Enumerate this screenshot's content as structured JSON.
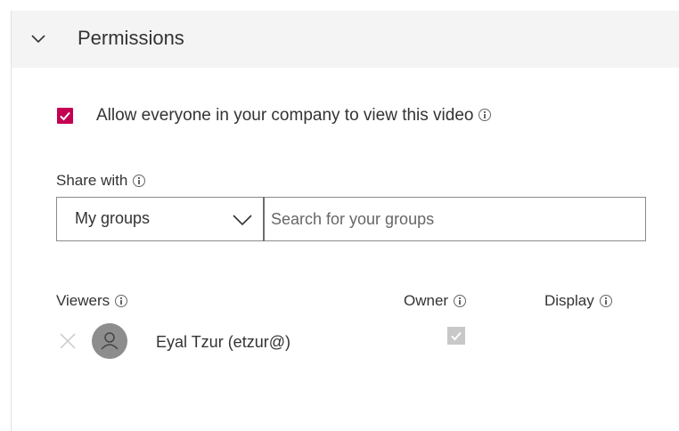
{
  "section": {
    "title": "Permissions",
    "expanded": true
  },
  "allow_everyone": {
    "label": "Allow everyone in your company to view this video",
    "checked": true,
    "checkbox_color": "#c30052"
  },
  "share_with": {
    "label": "Share with",
    "dropdown_value": "My groups",
    "search_placeholder": "Search for your groups"
  },
  "viewers": {
    "columns": {
      "viewers": "Viewers",
      "owner": "Owner",
      "display": "Display"
    },
    "rows": [
      {
        "name": "Eyal Tzur (etzur@)",
        "owner_checked": true,
        "owner_disabled": true
      }
    ]
  },
  "icons": {
    "collapse": "chevron-down-icon",
    "info": "info-icon",
    "remove": "close-icon",
    "avatar": "person-icon"
  }
}
